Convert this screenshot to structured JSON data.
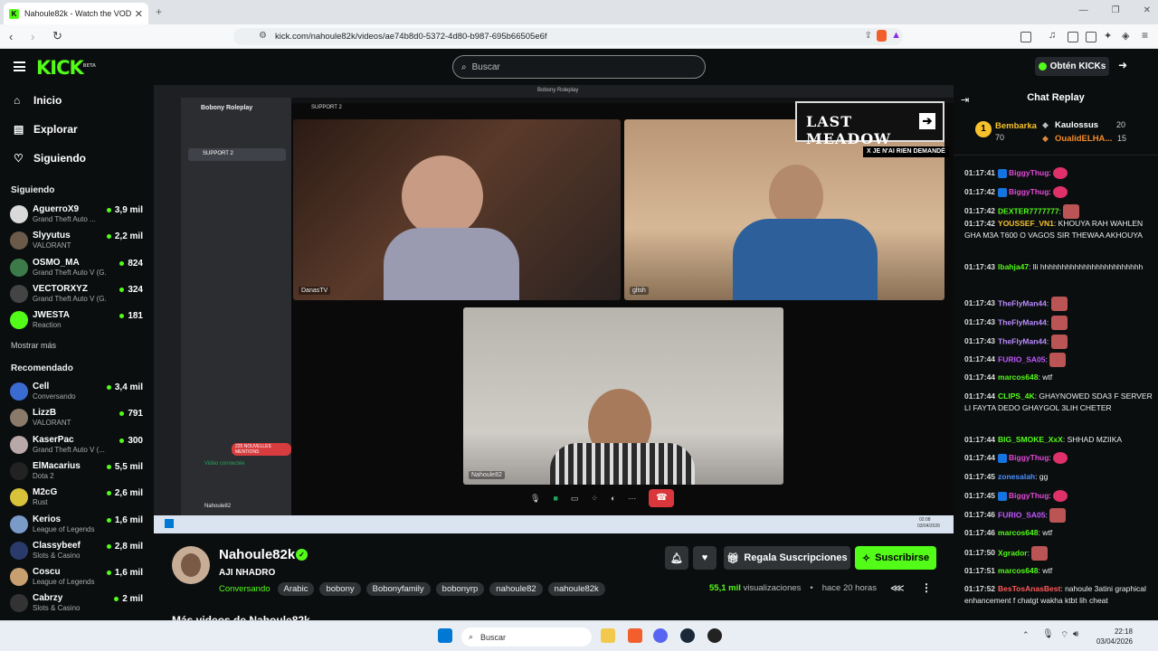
{
  "browser": {
    "tab_title": "Nahoule82k - Watch the VOD",
    "url": "kick.com/nahoule82k/videos/ae74b8d0-5372-4d80-b987-695b66505e6f"
  },
  "header": {
    "logo": "KICK",
    "logo_badge": "BETA",
    "search_placeholder": "Buscar",
    "get_kicks": "Obtén KICKs"
  },
  "sidebar": {
    "nav": [
      "Inicio",
      "Explorar",
      "Siguiendo"
    ],
    "following_title": "Siguiendo",
    "following": [
      {
        "name": "AguerroX9",
        "game": "Grand Theft Auto ...",
        "viewers": "3,9 mil",
        "color": "#d9d9d9"
      },
      {
        "name": "Slyyutus",
        "game": "VALORANT",
        "viewers": "2,2 mil",
        "color": "#6b5a4a"
      },
      {
        "name": "OSMO_MA",
        "game": "Grand Theft Auto V (G...",
        "viewers": "824",
        "color": "#3c7a4a"
      },
      {
        "name": "VECTORXYZ",
        "game": "Grand Theft Auto V (G...",
        "viewers": "324",
        "color": "#444"
      },
      {
        "name": "JWESTA",
        "game": "Reaction",
        "viewers": "181",
        "color": "#53fc18"
      }
    ],
    "show_more": "Mostrar más",
    "recommended_title": "Recomendado",
    "recommended": [
      {
        "name": "Cell",
        "game": "Conversando",
        "viewers": "3,4 mil",
        "color": "#3a6bd1"
      },
      {
        "name": "LizzB",
        "game": "VALORANT",
        "viewers": "791",
        "color": "#8a7a6a"
      },
      {
        "name": "KaserPac",
        "game": "Grand Theft Auto V (...",
        "viewers": "300",
        "color": "#b8a8a8"
      },
      {
        "name": "ElMacarius",
        "game": "Dota 2",
        "viewers": "5,5 mil",
        "color": "#222"
      },
      {
        "name": "M2cG",
        "game": "Rust",
        "viewers": "2,6 mil",
        "color": "#d8c23a"
      },
      {
        "name": "Kerios",
        "game": "League of Legends",
        "viewers": "1,6 mil",
        "color": "#7a9ac8"
      },
      {
        "name": "Classybeef",
        "game": "Slots & Casino",
        "viewers": "2,8 mil",
        "color": "#2a3a6a"
      },
      {
        "name": "Coscu",
        "game": "League of Legends",
        "viewers": "1,6 mil",
        "color": "#c8a070"
      },
      {
        "name": "Cabrzy",
        "game": "Slots & Casino",
        "viewers": "2 mil",
        "color": "#333"
      }
    ]
  },
  "video": {
    "discord_server": "Bobony Roleplay",
    "channel": "SUPPORT 2",
    "banner_text": "LAST MEADOW",
    "banner_sub": "X JE N'AI RIEN DEMANDÉ",
    "participants": [
      "DanasTV",
      "gltsh",
      "Nahoule82"
    ],
    "voice_status": "Vidéo connectée",
    "user_name": "Nahoule82",
    "new_mentions": "225 NOUVELLES MENTIONS",
    "taskbar_time": "02:08",
    "taskbar_date": "03/04/2026"
  },
  "stream": {
    "name": "Nahoule82k",
    "title": "AJI NHADRO",
    "category": "Conversando",
    "tags": [
      "Arabic",
      "bobony",
      "Bobonyfamily",
      "bobonyrp",
      "nahoule82",
      "nahoule82k"
    ],
    "views_count": "55,1 mil",
    "views_label": "visualizaciones",
    "age": "hace 20 horas",
    "gift_label": "Regala Suscripciones",
    "subscribe_label": "Suscribirse",
    "more_videos": "Más videos de Nahoule82k"
  },
  "chat": {
    "title": "Chat Replay",
    "leaderboard": [
      {
        "rank": "1",
        "name": "Bembarka",
        "score": "70"
      },
      {
        "name": "Kaulossus",
        "score": "20"
      },
      {
        "name": "OualidELHA...",
        "score": "15"
      }
    ],
    "messages": [
      {
        "time": "01:17:41",
        "user": "BiggyThug",
        "color": "#e14bd6",
        "badge": true,
        "text": "",
        "emote": "pink"
      },
      {
        "time": "01:17:42",
        "user": "BiggyThug",
        "color": "#e14bd6",
        "badge": true,
        "text": "",
        "emote": "pink"
      },
      {
        "time": "01:17:42",
        "user": "DEXTER7777777",
        "color": "#53fc18",
        "badge": false,
        "text": "",
        "emote": "face"
      },
      {
        "time": "01:17:42",
        "user": "YOUSSEF_VN1",
        "color": "#f6c12b",
        "badge": false,
        "text": "KHOUYA RAH WAHLEN GHA M3A T600 O VAGOS SIR THEWAA AKHOUYA",
        "emote": ""
      },
      {
        "time": "01:17:43",
        "user": "lbahja47",
        "color": "#53fc18",
        "badge": false,
        "text": "lli hhhhhhhhhhhhhhhhhhhhhhhh",
        "emote": ""
      },
      {
        "time": "01:17:43",
        "user": "TheFlyMan44",
        "color": "#b98bff",
        "badge": false,
        "text": "",
        "emote": "face"
      },
      {
        "time": "01:17:43",
        "user": "TheFlyMan44",
        "color": "#b98bff",
        "badge": false,
        "text": "",
        "emote": "face"
      },
      {
        "time": "01:17:43",
        "user": "TheFlyMan44",
        "color": "#b98bff",
        "badge": false,
        "text": "",
        "emote": "face"
      },
      {
        "time": "01:17:44",
        "user": "FURIO_SA05",
        "color": "#c158ff",
        "badge": false,
        "text": "",
        "emote": "face"
      },
      {
        "time": "01:17:44",
        "user": "marcos648",
        "color": "#53fc18",
        "badge": false,
        "text": "wtf",
        "emote": ""
      },
      {
        "time": "01:17:44",
        "user": "CLIPS_4K",
        "color": "#53fc18",
        "badge": false,
        "text": "GHAYNOWED SDA3 F SERVER LI FAYTA DEDO GHAYGOL 3LIH CHETER",
        "emote": ""
      },
      {
        "time": "01:17:44",
        "user": "BIG_SMOKE_XxX",
        "color": "#53fc18",
        "badge": false,
        "text": "SHHAD MZIIKA",
        "emote": ""
      },
      {
        "time": "01:17:44",
        "user": "BiggyThug",
        "color": "#e14bd6",
        "badge": true,
        "text": "",
        "emote": "pink"
      },
      {
        "time": "01:17:45",
        "user": "zonesalah",
        "color": "#4a90ff",
        "badge": false,
        "text": "gg",
        "emote": ""
      },
      {
        "time": "01:17:45",
        "user": "BiggyThug",
        "color": "#e14bd6",
        "badge": true,
        "text": "",
        "emote": "pink"
      },
      {
        "time": "01:17:46",
        "user": "FURIO_SA05",
        "color": "#c158ff",
        "badge": false,
        "text": "",
        "emote": "face"
      },
      {
        "time": "01:17:46",
        "user": "marcos648",
        "color": "#53fc18",
        "badge": false,
        "text": "wtf",
        "emote": ""
      },
      {
        "time": "01:17:50",
        "user": "Xgrador",
        "color": "#53fc18",
        "badge": false,
        "text": "",
        "emote": "face"
      },
      {
        "time": "01:17:51",
        "user": "marcos648",
        "color": "#53fc18",
        "badge": false,
        "text": "wtf",
        "emote": ""
      },
      {
        "time": "01:17:52",
        "user": "BesTosAnasBest",
        "color": "#ff5a5a",
        "badge": false,
        "text": "nahoule 3atini graphical enhancement f chatgt wakha ktbt lih cheat",
        "emote": ""
      }
    ]
  },
  "taskbar": {
    "search": "Buscar",
    "time": "22:18",
    "date": "03/04/2026"
  }
}
